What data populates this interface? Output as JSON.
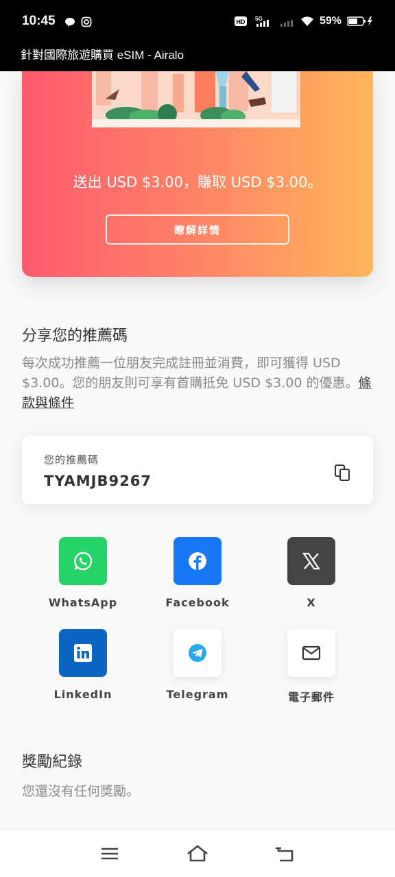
{
  "status_bar": {
    "time": "10:45",
    "battery": "59%"
  },
  "title_bar": {
    "title": "針對國際旅遊購買 eSIM - Airalo"
  },
  "promo": {
    "text": "送出 USD $3.00，賺取 USD $3.00。",
    "button_label": "瞭解詳情",
    "gradient_colors": [
      "#ff5a6e",
      "#ffb55a"
    ]
  },
  "share_section": {
    "title": "分享您的推薦碼",
    "description": "每次成功推薦一位朋友完成註冊並消費，即可獲得 USD $3.00。您的朋友則可享有首購抵免 USD $3.00 的優惠。",
    "terms_link": "條款與條件"
  },
  "referral_code": {
    "label": "您的推薦碼",
    "value": "TYAMJB9267"
  },
  "share_targets": [
    {
      "label": "WhatsApp",
      "icon": "whatsapp-icon",
      "color": "#25d366"
    },
    {
      "label": "Facebook",
      "icon": "facebook-icon",
      "color": "#1877f2"
    },
    {
      "label": "X",
      "icon": "x-icon",
      "color": "#444444"
    },
    {
      "label": "LinkedIn",
      "icon": "linkedin-icon",
      "color": "#0a66c2"
    },
    {
      "label": "Telegram",
      "icon": "telegram-icon",
      "color": "#29a9eb"
    },
    {
      "label": "電子郵件",
      "icon": "mail-icon",
      "color": "#333333"
    }
  ],
  "rewards": {
    "title": "獎勵紀錄",
    "empty_text": "您還沒有任何獎勵。"
  }
}
